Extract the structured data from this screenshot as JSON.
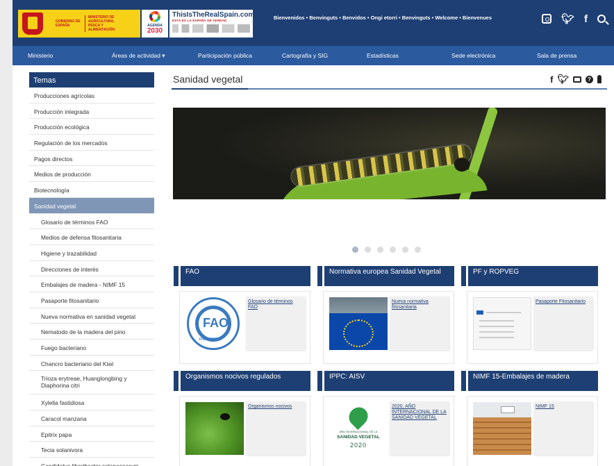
{
  "header": {
    "gov_line1": "GOBIERNO DE ESPAÑA",
    "gov_line2": "MINISTERIO DE AGRICULTURA, PESCA Y ALIMENTACIÓN",
    "agenda_label": "AGENDA",
    "agenda_year": "2030",
    "realspain_title": "ThisIsTheRealSpain.com",
    "realspain_tagline": "ESTA ES LA ESPAÑA DE VERDAD",
    "welcome": "Bienvenidos • Benvinguts • Benvidos • Ongi etorri • Benvinguts • Welcome • Bienvenues",
    "social_icons": [
      "instagram-icon",
      "twitter-icon",
      "facebook-icon",
      "search-icon"
    ]
  },
  "nav": {
    "items": [
      "Ministerio",
      "Áreas de actividad ▾",
      "Participación pública",
      "Cartografía y SIG",
      "Estadísticas",
      "Sede electrónica",
      "Sala de prensa"
    ]
  },
  "sidebar": {
    "heading": "Temas",
    "items": [
      "Producciones agrícolas",
      "Producción integrada",
      "Producción ecológica",
      "Regulación de los mercados",
      "Pagos directos",
      "Medios de producción",
      "Biotecnología"
    ],
    "active": "Sanidad vegetal",
    "subitems": [
      "Glosario de términos FAO",
      "Medios de defensa fitosanitaria",
      "Higiene y trazabilidad",
      "Direcciones de interés",
      "Embalajes de madera - NIMF 15",
      "Pasaporte fitosanitario",
      "Nueva normativa en sanidad vegetal",
      "Nematodo de la madera del pino",
      "Fuego bacteriano",
      "Chancro bacteriano del Kiwi",
      "Trioza erytreae, Huanglongbing y Diaphorina citri",
      "Xylella fastidiosa",
      "Caracol manzana",
      "Epitrix papa",
      "Tecia solanivora",
      "Candidatus liberibacter solanacearum"
    ]
  },
  "main": {
    "title": "Sanidad vegetal",
    "share_icons": [
      "facebook-icon",
      "twitter-icon",
      "print-icon",
      "help-icon",
      "accessibility-icon"
    ],
    "carousel_dots": 6,
    "carousel_active": 1
  },
  "cards": [
    {
      "heading": "FAO",
      "link": "Glosario de términos FAO",
      "thumb_text": "FAO",
      "thumb_sub": "FIAT PANIS"
    },
    {
      "heading": "Normativa europea Sanidad Vegetal",
      "link": "Nueva normativa fitosanitaria"
    },
    {
      "heading": "PF y ROPVEG",
      "link": "Pasaporte Fitosanitario"
    },
    {
      "heading": "Organismos nocivos regulados",
      "link": "Organismos nocivos"
    },
    {
      "heading": "IPPC: AISV",
      "link": "2020, AÑO INTERNACIONAL DE LA SANIDAD VEGETAL",
      "thumb_line1": "AÑO INTERNACIONAL DE LA",
      "thumb_line2": "SANIDAD VEGETAL",
      "thumb_line3": "2020"
    },
    {
      "heading": "NIMF 15-Embalajes de madera",
      "link": "NIMF 15"
    }
  ]
}
